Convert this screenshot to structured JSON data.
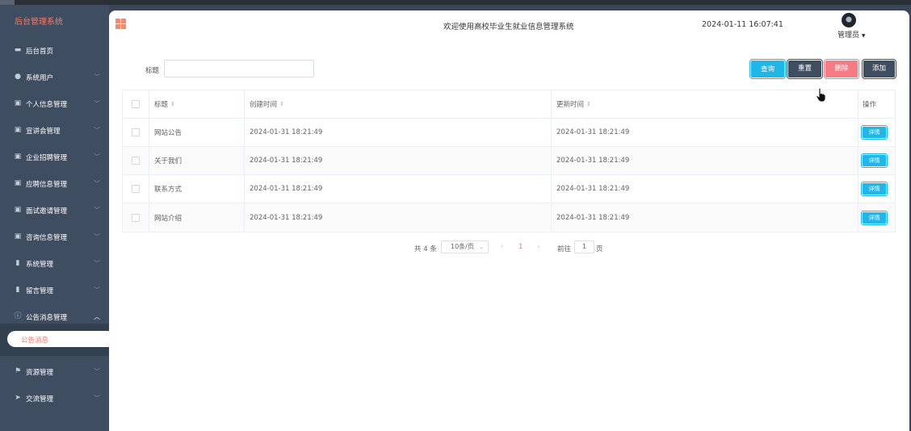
{
  "sidebar": {
    "brand": "后台管理系统",
    "items": [
      {
        "label": "后台首页",
        "icon": "monitor-icon",
        "glyph": "▬",
        "chevron": false
      },
      {
        "label": "系统用户",
        "icon": "user-icon",
        "glyph": "●",
        "chevron": true
      },
      {
        "label": "个人信息管理",
        "icon": "form-icon",
        "glyph": "▣",
        "chevron": true
      },
      {
        "label": "宣讲会管理",
        "icon": "form-icon",
        "glyph": "▣",
        "chevron": true
      },
      {
        "label": "企业招聘管理",
        "icon": "form-icon",
        "glyph": "▣",
        "chevron": true
      },
      {
        "label": "应聘信息管理",
        "icon": "form-icon",
        "glyph": "▣",
        "chevron": true
      },
      {
        "label": "面试邀请管理",
        "icon": "form-icon",
        "glyph": "▣",
        "chevron": true
      },
      {
        "label": "咨询信息管理",
        "icon": "form-icon",
        "glyph": "▣",
        "chevron": true
      },
      {
        "label": "系统管理",
        "icon": "bar-chart-icon",
        "glyph": "▮",
        "chevron": true
      },
      {
        "label": "留言管理",
        "icon": "bar-chart-icon",
        "glyph": "▮",
        "chevron": true
      },
      {
        "label": "公告消息管理",
        "icon": "info-icon",
        "glyph": "ⓘ",
        "chevron": true,
        "expanded": true
      }
    ],
    "active_sub": "公告消息",
    "items_after": [
      {
        "label": "资源管理",
        "icon": "flag-icon",
        "glyph": "⚑",
        "chevron": true
      },
      {
        "label": "交流管理",
        "icon": "send-icon",
        "glyph": "➤",
        "chevron": true
      }
    ]
  },
  "header": {
    "welcome": "欢迎使用高校毕业生就业信息管理系统",
    "datetime": "2024-01-11 16:07:41",
    "user": "管理员"
  },
  "search": {
    "label": "标题",
    "value": ""
  },
  "buttons": {
    "query": "查询",
    "reset": "重置",
    "delete": "删除",
    "add": "添加"
  },
  "table": {
    "headers": {
      "title": "标题",
      "created": "创建时间",
      "updated": "更新时间",
      "action": "操作"
    },
    "rows": [
      {
        "title": "网站公告",
        "created": "2024-01-31 18:21:49",
        "updated": "2024-01-31 18:21:49",
        "action": "详情"
      },
      {
        "title": "关于我们",
        "created": "2024-01-31 18:21:49",
        "updated": "2024-01-31 18:21:49",
        "action": "详情"
      },
      {
        "title": "联系方式",
        "created": "2024-01-31 18:21:49",
        "updated": "2024-01-31 18:21:49",
        "action": "详情"
      },
      {
        "title": "网站介绍",
        "created": "2024-01-31 18:21:49",
        "updated": "2024-01-31 18:21:49",
        "action": "详情"
      }
    ]
  },
  "pagination": {
    "total": "共 4 条",
    "page_size": "10条/页",
    "current": "1",
    "goto_label": "前往",
    "goto_value": "1",
    "page_suffix": "页"
  },
  "colors": {
    "sidebar_bg": "#3f4d61",
    "accent": "#f37b6a",
    "primary": "#1fb6e8",
    "danger": "#f57b84"
  }
}
